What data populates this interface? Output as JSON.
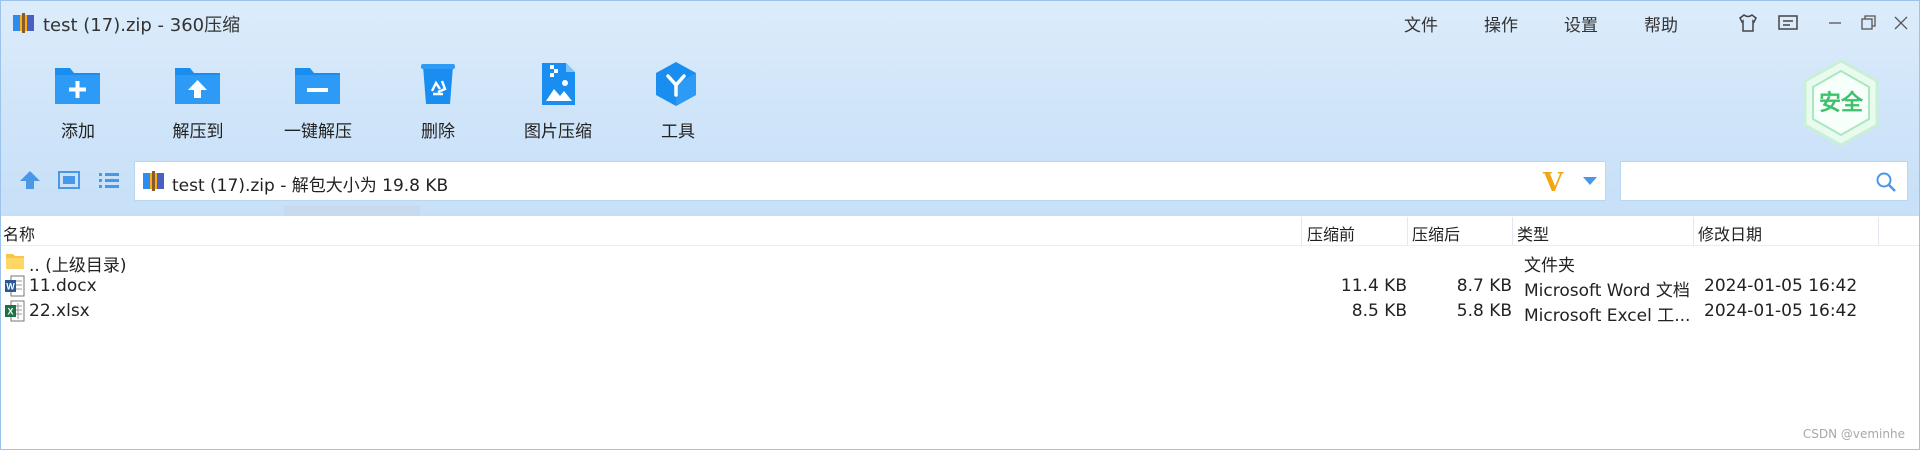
{
  "window": {
    "title": "test (17).zip - 360压缩"
  },
  "menu": {
    "items": [
      "文件",
      "操作",
      "设置",
      "帮助"
    ]
  },
  "window_controls": {
    "icons": [
      "skin-icon",
      "feedback-icon",
      "minimize-icon",
      "restore-icon",
      "close-icon"
    ]
  },
  "toolbar": {
    "items": [
      {
        "label": "添加",
        "icon": "add-folder-icon"
      },
      {
        "label": "解压到",
        "icon": "extract-to-icon"
      },
      {
        "label": "一键解压",
        "icon": "one-click-extract-icon"
      },
      {
        "label": "删除",
        "icon": "recycle-bin-icon"
      },
      {
        "label": "图片压缩",
        "icon": "image-compress-icon"
      },
      {
        "label": "工具",
        "icon": "tools-icon"
      }
    ],
    "icon_color": "#1a8ef0"
  },
  "security": {
    "label": "安全",
    "color": "#3cc16b"
  },
  "address": {
    "text": "test (17).zip - 解包大小为 19.8 KB",
    "v_badge": "V"
  },
  "search": {
    "placeholder": ""
  },
  "columns": {
    "name": "名称",
    "size_before": "压缩前",
    "size_after": "压缩后",
    "type": "类型",
    "modified": "修改日期"
  },
  "rows": [
    {
      "name": ".. (上级目录)",
      "size_before": "",
      "size_after": "",
      "type": "文件夹",
      "modified": "",
      "icon": "folder-icon"
    },
    {
      "name": "11.docx",
      "size_before": "11.4 KB",
      "size_after": "8.7 KB",
      "type": "Microsoft Word 文档",
      "modified": "2024-01-05 16:42",
      "icon": "word-file-icon"
    },
    {
      "name": "22.xlsx",
      "size_before": "8.5 KB",
      "size_after": "5.8 KB",
      "type": "Microsoft Excel 工...",
      "modified": "2024-01-05 16:42",
      "icon": "excel-file-icon"
    }
  ],
  "watermark": "CSDN @veminhe"
}
